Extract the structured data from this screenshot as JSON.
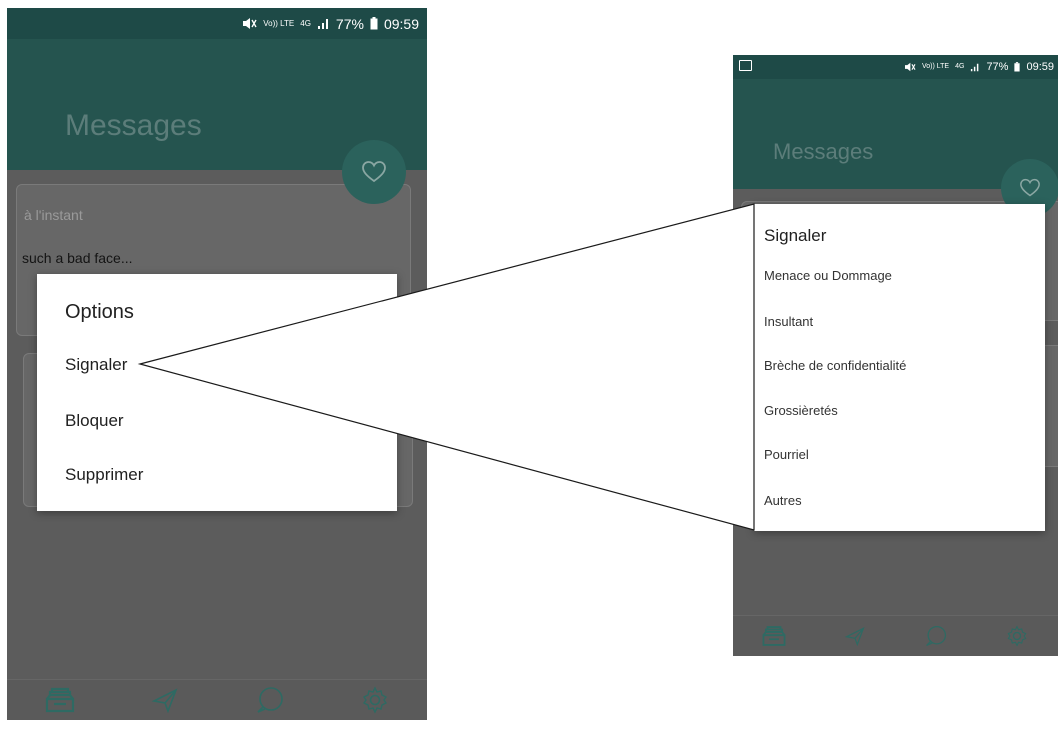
{
  "status_bar": {
    "volte": "Vo)) LTE",
    "network": "4G",
    "battery": "77%",
    "time": "09:59"
  },
  "header": {
    "title": "Messages"
  },
  "messages": [
    {
      "time": "à l'instant",
      "text": "such a bad face..."
    }
  ],
  "options_dialog": {
    "title": "Options",
    "items": [
      "Signaler",
      "Bloquer",
      "Supprimer"
    ]
  },
  "report_dialog": {
    "title": "Signaler",
    "items": [
      "Menace ou Dommage",
      "Insultant",
      "Brèche de confidentialité",
      "Grossièretés",
      "Pourriel",
      "Autres"
    ]
  },
  "bottom_nav": {
    "items": [
      "inbox-icon",
      "send-icon",
      "chat-bubble-icon",
      "settings-gear-icon"
    ]
  },
  "colors": {
    "header": "#25544f",
    "status_bar": "#1e4a47",
    "fab": "#2b625c",
    "dim_background": "#5c5c5c",
    "dialog": "#ffffff"
  }
}
